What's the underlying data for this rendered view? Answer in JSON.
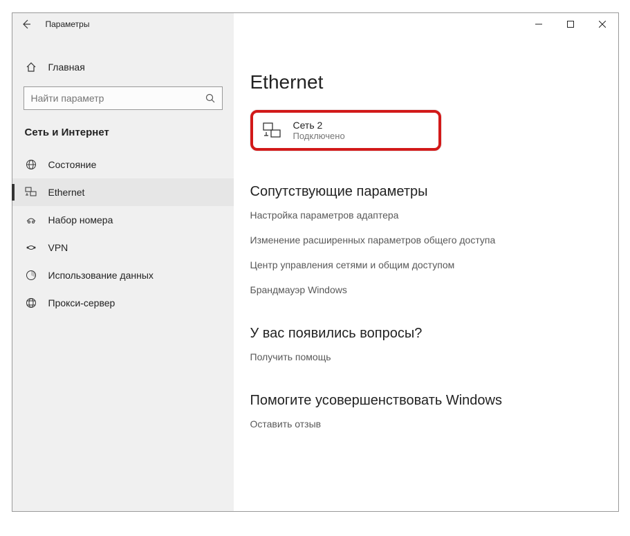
{
  "titlebar": {
    "title": "Параметры"
  },
  "sidebar": {
    "home": "Главная",
    "search_placeholder": "Найти параметр",
    "section": "Сеть и Интернет",
    "items": [
      {
        "label": "Состояние"
      },
      {
        "label": "Ethernet"
      },
      {
        "label": "Набор номера"
      },
      {
        "label": "VPN"
      },
      {
        "label": "Использование данных"
      },
      {
        "label": "Прокси-сервер"
      }
    ]
  },
  "content": {
    "heading": "Ethernet",
    "network": {
      "name": "Сеть 2",
      "status": "Подключено"
    },
    "related": {
      "title": "Сопутствующие параметры",
      "links": [
        "Настройка параметров адаптера",
        "Изменение расширенных параметров общего доступа",
        "Центр управления сетями и общим доступом",
        "Брандмауэр Windows"
      ]
    },
    "questions": {
      "title": "У вас появились вопросы?",
      "link": "Получить помощь"
    },
    "feedback": {
      "title": "Помогите усовершенствовать Windows",
      "link": "Оставить отзыв"
    }
  }
}
